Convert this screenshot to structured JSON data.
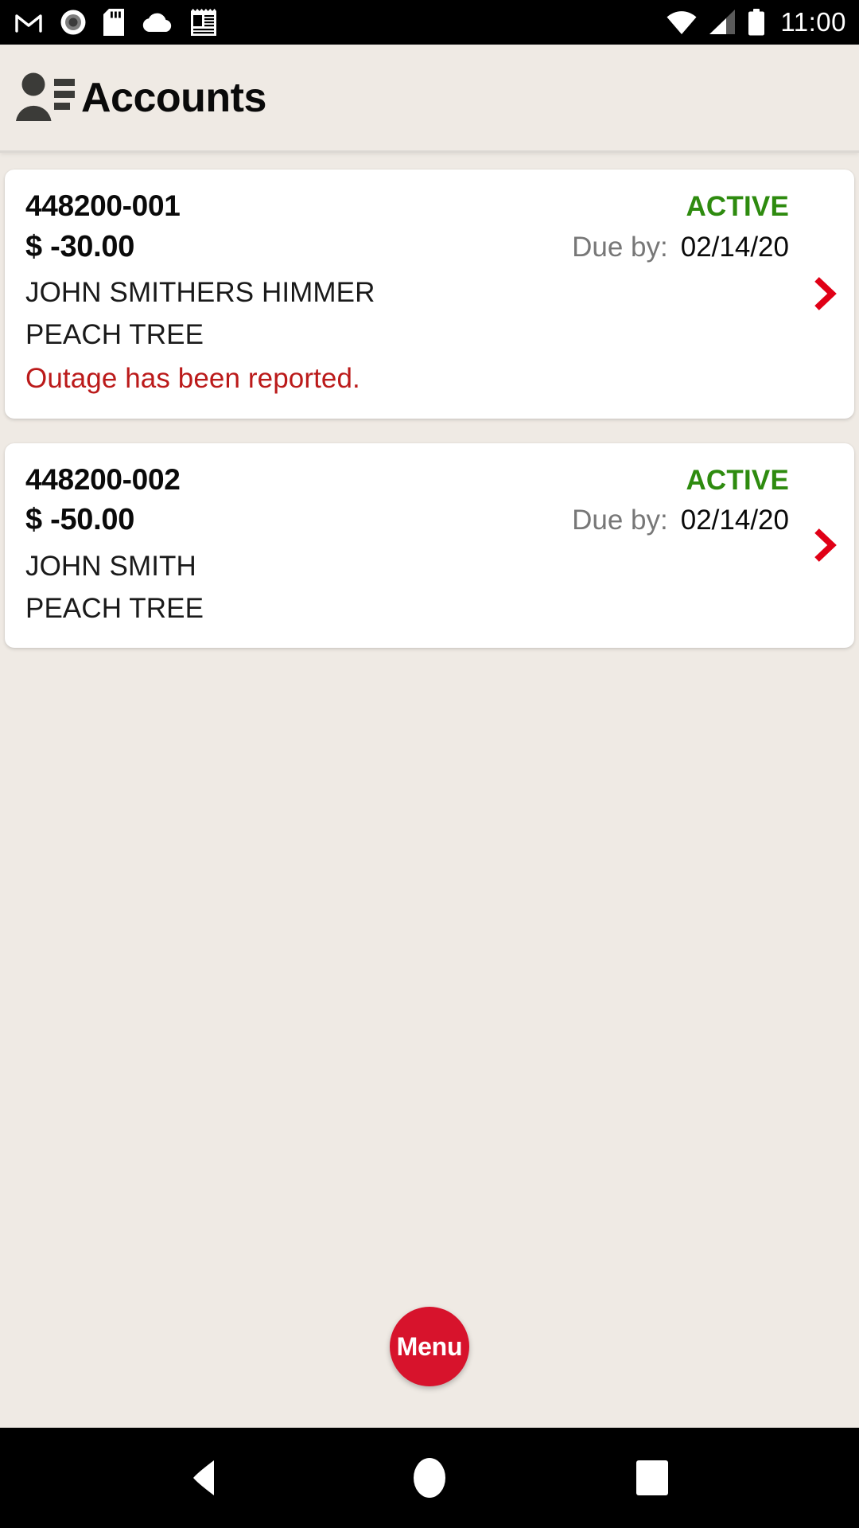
{
  "status_bar": {
    "time": "11:00",
    "left_icons": [
      {
        "name": "gmail-icon"
      },
      {
        "name": "screen-record-icon"
      },
      {
        "name": "sd-card-icon"
      },
      {
        "name": "cloud-icon"
      },
      {
        "name": "news-icon"
      }
    ],
    "right_icons": [
      {
        "name": "wifi-icon"
      },
      {
        "name": "cellular-signal-icon"
      },
      {
        "name": "battery-icon"
      }
    ],
    "background": "#000000",
    "foreground": "#ffffff"
  },
  "header": {
    "title": "Accounts",
    "icon": "contact-details-icon",
    "background": "#efeae4"
  },
  "colors": {
    "page_background": "#efeae4",
    "card_background": "#ffffff",
    "status_active": "#2e8b0f",
    "alert_red": "#bb1a1a",
    "chevron_red": "#e00016",
    "fab_red": "#d7132c",
    "muted_label": "#777777"
  },
  "accounts": [
    {
      "number": "448200-001",
      "status": "ACTIVE",
      "balance": "$ -30.00",
      "due_label": "Due by:",
      "due_date": "02/14/20",
      "name": "JOHN SMITHERS HIMMER",
      "address": "PEACH TREE",
      "alert": "Outage has been reported.",
      "chevron": "chevron-right-icon"
    },
    {
      "number": "448200-002",
      "status": "ACTIVE",
      "balance": "$ -50.00",
      "due_label": "Due by:",
      "due_date": "02/14/20",
      "name": "JOHN SMITH",
      "address": "PEACH TREE",
      "alert": "",
      "chevron": "chevron-right-icon"
    }
  ],
  "fab": {
    "label": "Menu"
  },
  "nav_bar": {
    "back": "back-triangle-icon",
    "home": "home-circle-icon",
    "recents": "recents-square-icon"
  }
}
